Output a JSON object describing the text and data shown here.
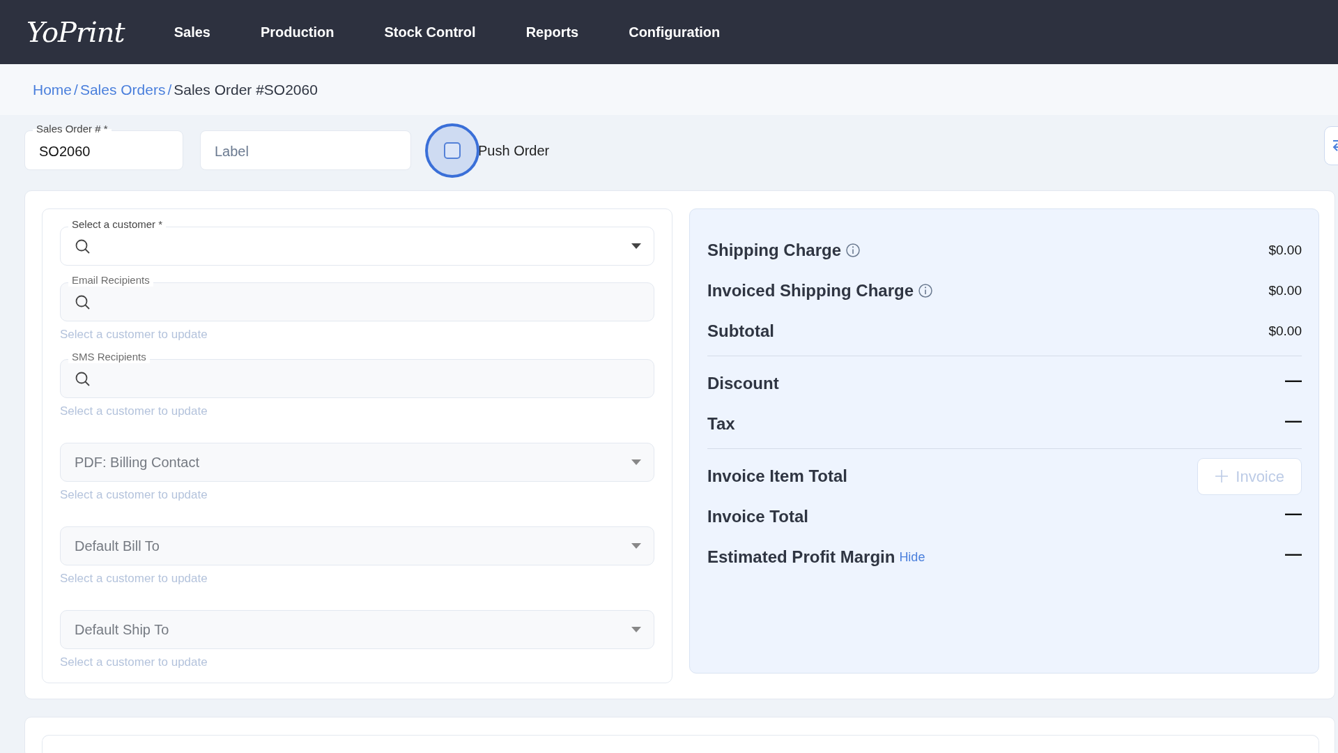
{
  "nav": {
    "logo": "YoPrint",
    "items": [
      {
        "label": "Sales"
      },
      {
        "label": "Production"
      },
      {
        "label": "Stock Control"
      },
      {
        "label": "Reports"
      },
      {
        "label": "Configuration"
      }
    ]
  },
  "breadcrumb": {
    "separator": "/",
    "items": [
      {
        "label": "Home",
        "kind": "link"
      },
      {
        "label": "Sales Orders",
        "kind": "link"
      },
      {
        "label": "Sales Order #SO2060",
        "kind": "current"
      }
    ]
  },
  "order_form": {
    "sales_order": {
      "label": "Sales Order # *",
      "value": "SO2060"
    },
    "label_field": {
      "placeholder": "Label"
    },
    "push_order": {
      "label": "Push Order",
      "checked": false
    }
  },
  "customer_panel": {
    "fields": [
      {
        "kind": "search-select",
        "label": "Select a customer *",
        "disabled": false
      },
      {
        "kind": "search",
        "label": "Email Recipients",
        "disabled": true,
        "hint": "Select a customer to update"
      },
      {
        "kind": "search",
        "label": "SMS Recipients",
        "disabled": true,
        "hint": "Select a customer to update"
      },
      {
        "kind": "select",
        "placeholder": "PDF: Billing Contact",
        "disabled": true,
        "hint": "Select a customer to update"
      },
      {
        "kind": "select",
        "placeholder": "Default Bill To",
        "disabled": true,
        "hint": "Select a customer to update"
      },
      {
        "kind": "select",
        "placeholder": "Default Ship To",
        "disabled": true,
        "hint": "Select a customer to update"
      }
    ]
  },
  "summary": {
    "rows": [
      {
        "kind": "value",
        "label": "Shipping Charge",
        "info": true,
        "value": "$0.00"
      },
      {
        "kind": "value",
        "label": "Invoiced Shipping Charge",
        "info": true,
        "value": "$0.00"
      },
      {
        "kind": "value",
        "label": "Subtotal",
        "value": "$0.00",
        "divider_after": true
      },
      {
        "kind": "value",
        "label": "Discount",
        "value": "—"
      },
      {
        "kind": "value",
        "label": "Tax",
        "value": "—",
        "divider_after": true
      },
      {
        "kind": "button",
        "label": "Invoice Item Total",
        "button": {
          "label": "Invoice",
          "disabled": true
        }
      },
      {
        "kind": "value",
        "label": "Invoice Total",
        "value": "—"
      },
      {
        "kind": "value",
        "label": "Estimated Profit Margin",
        "link": "Hide",
        "value": "—"
      }
    ]
  }
}
